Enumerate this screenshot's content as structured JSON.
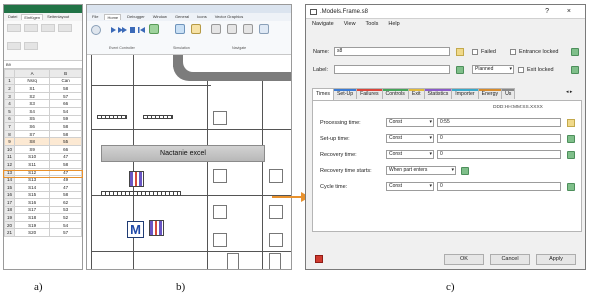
{
  "captions": {
    "a": "a)",
    "b": "b)",
    "c": "c)"
  },
  "excel": {
    "ribbon_tabs": [
      "Datei",
      "Einfügen",
      "Seitenlayout"
    ],
    "name_box": "B9",
    "col_headers": [
      "",
      "A",
      "B"
    ],
    "header_row": {
      "rn": "1",
      "a": "Nsrq",
      "b": "Can"
    },
    "rows": [
      {
        "rn": "2",
        "a": "S1",
        "b": "58"
      },
      {
        "rn": "3",
        "a": "S2",
        "b": "57"
      },
      {
        "rn": "4",
        "a": "S3",
        "b": "66"
      },
      {
        "rn": "5",
        "a": "S4",
        "b": "54"
      },
      {
        "rn": "6",
        "a": "S5",
        "b": "59"
      },
      {
        "rn": "7",
        "a": "S6",
        "b": "58"
      },
      {
        "rn": "8",
        "a": "S7",
        "b": "58"
      },
      {
        "rn": "9",
        "a": "S8",
        "b": "55"
      },
      {
        "rn": "10",
        "a": "S9",
        "b": "66"
      },
      {
        "rn": "11",
        "a": "S10",
        "b": "47"
      },
      {
        "rn": "12",
        "a": "S11",
        "b": "58"
      },
      {
        "rn": "13",
        "a": "S12",
        "b": "47"
      },
      {
        "rn": "14",
        "a": "S13",
        "b": "49"
      },
      {
        "rn": "15",
        "a": "S14",
        "b": "47"
      },
      {
        "rn": "16",
        "a": "S15",
        "b": "58"
      },
      {
        "rn": "17",
        "a": "S16",
        "b": "62"
      },
      {
        "rn": "18",
        "a": "S17",
        "b": "53"
      },
      {
        "rn": "19",
        "a": "S18",
        "b": "52"
      },
      {
        "rn": "20",
        "a": "S19",
        "b": "54"
      },
      {
        "rn": "21",
        "a": "S20",
        "b": "57"
      }
    ],
    "highlight_color": "#e8912d"
  },
  "plant": {
    "tabs": [
      "File",
      "Home",
      "Debugger",
      "Window",
      "General",
      "Icons",
      "Vector Graphics"
    ],
    "ribbon_groups": [
      "Event Controller",
      "Simulation",
      "Navigate"
    ],
    "canvas_label": "Nactanie excel",
    "method_icon": "M"
  },
  "dialog": {
    "title": ".Models.Frame.s8",
    "controls": "? ×",
    "menu": [
      "Navigate",
      "View",
      "Tools",
      "Help"
    ],
    "name_label": "Name:",
    "name_value": "s8",
    "label_label": "Label:",
    "label_value": "",
    "failed_label": "Failed",
    "entrance_locked_label": "Entrance locked",
    "planned_value": "Planned",
    "exit_locked_label": "Exit locked",
    "tabs": [
      "Times",
      "Set-Up",
      "Failures",
      "Controls",
      "Exit",
      "Statistics",
      "Importer",
      "Energy",
      "Us"
    ],
    "tab_colors": [
      "#ffffff",
      "#3b7bd4",
      "#d9453b",
      "#46a35a",
      "#e0b93c",
      "#8a5bc8",
      "#3aa8c9",
      "#d68b2d",
      "#888888"
    ],
    "tab_scroll": "◂ ▸",
    "time_format": "DDD:HH:MM:SS.XXXX",
    "rows": [
      {
        "label": "Processing time:",
        "type": "Const",
        "value": "0:55"
      },
      {
        "label": "Set-up time:",
        "type": "Const",
        "value": "0"
      },
      {
        "label": "Recovery time:",
        "type": "Const",
        "value": "0"
      },
      {
        "label": "Recovery time starts:",
        "type": "When part enters",
        "value": ""
      },
      {
        "label": "Cycle time:",
        "type": "Const",
        "value": "0"
      }
    ],
    "buttons": {
      "ok": "OK",
      "cancel": "Cancel",
      "apply": "Apply"
    }
  },
  "arrow_color": "#e8912d"
}
